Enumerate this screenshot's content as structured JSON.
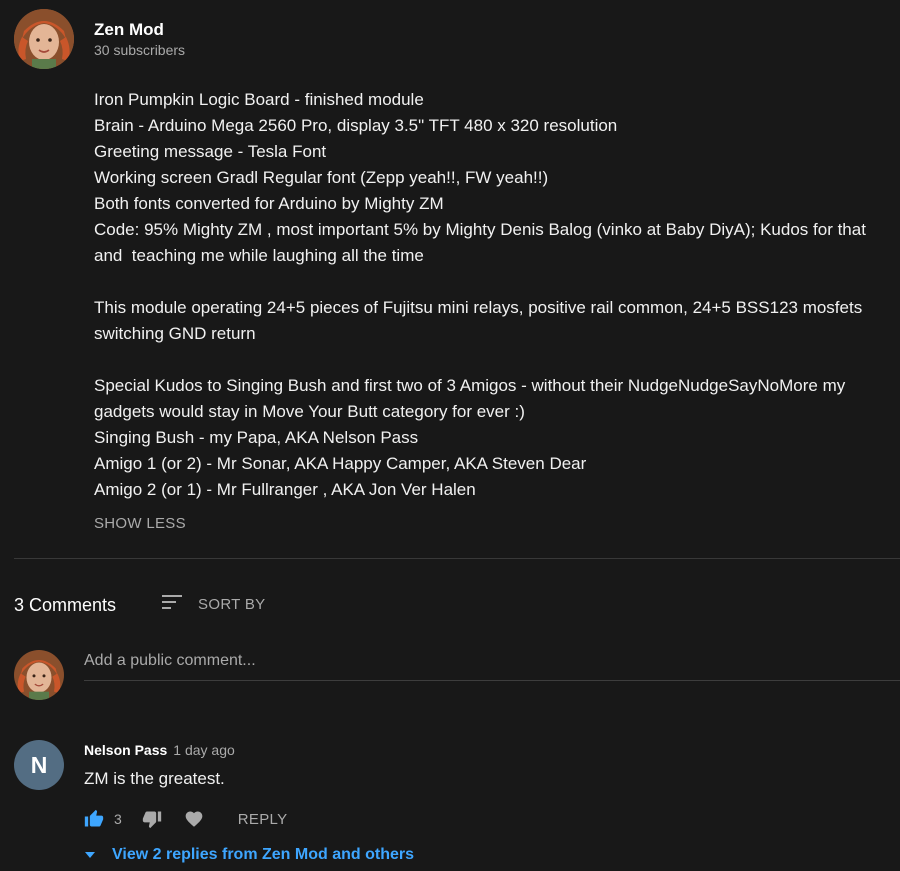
{
  "channel": {
    "name": "Zen Mod",
    "subscribers": "30 subscribers"
  },
  "description": {
    "lines": [
      "Iron Pumpkin Logic Board - finished module",
      "Brain - Arduino Mega 2560 Pro, display 3.5\" TFT 480 x 320 resolution",
      "Greeting message - Tesla Font",
      "Working screen Gradl Regular font (Zepp yeah!!, FW yeah!!)",
      "Both fonts converted for Arduino by Mighty ZM",
      "Code: 95% Mighty ZM , most important 5% by Mighty Denis Balog (vinko at Baby DiyA); Kudos for that and  teaching me while laughing all the time",
      "",
      "This module operating 24+5 pieces of Fujitsu mini relays, positive rail common, 24+5 BSS123 mosfets switching GND return",
      "",
      "Special Kudos to Singing Bush and first two of 3 Amigos - without their NudgeNudgeSayNoMore my gadgets would stay in Move Your Butt category for ever :)",
      "Singing Bush - my Papa, AKA Nelson Pass",
      "Amigo 1 (or 2) - Mr Sonar, AKA Happy Camper, AKA Steven Dear",
      "Amigo 2 (or 1) - Mr Fullranger , AKA Jon Ver Halen"
    ],
    "show_less_label": "SHOW LESS"
  },
  "comments": {
    "count_label": "3 Comments",
    "sort_label": "SORT BY",
    "add_placeholder": "Add a public comment...",
    "items": [
      {
        "avatar_letter": "N",
        "avatar_color": "#536d83",
        "author": "Nelson Pass",
        "time": "1 day ago",
        "text": "ZM is the greatest.",
        "likes": "3",
        "reply_label": "REPLY",
        "view_replies_label": "View 2 replies from Zen Mod and others"
      }
    ]
  },
  "colors": {
    "background": "#181818",
    "accent": "#3ea6ff",
    "secondary_text": "#aaaaaa"
  },
  "icons": {
    "sort": "sort-icon",
    "like": "thumbs-up-icon",
    "dislike": "thumbs-down-icon",
    "heart": "heart-icon",
    "expand": "caret-down-icon"
  }
}
